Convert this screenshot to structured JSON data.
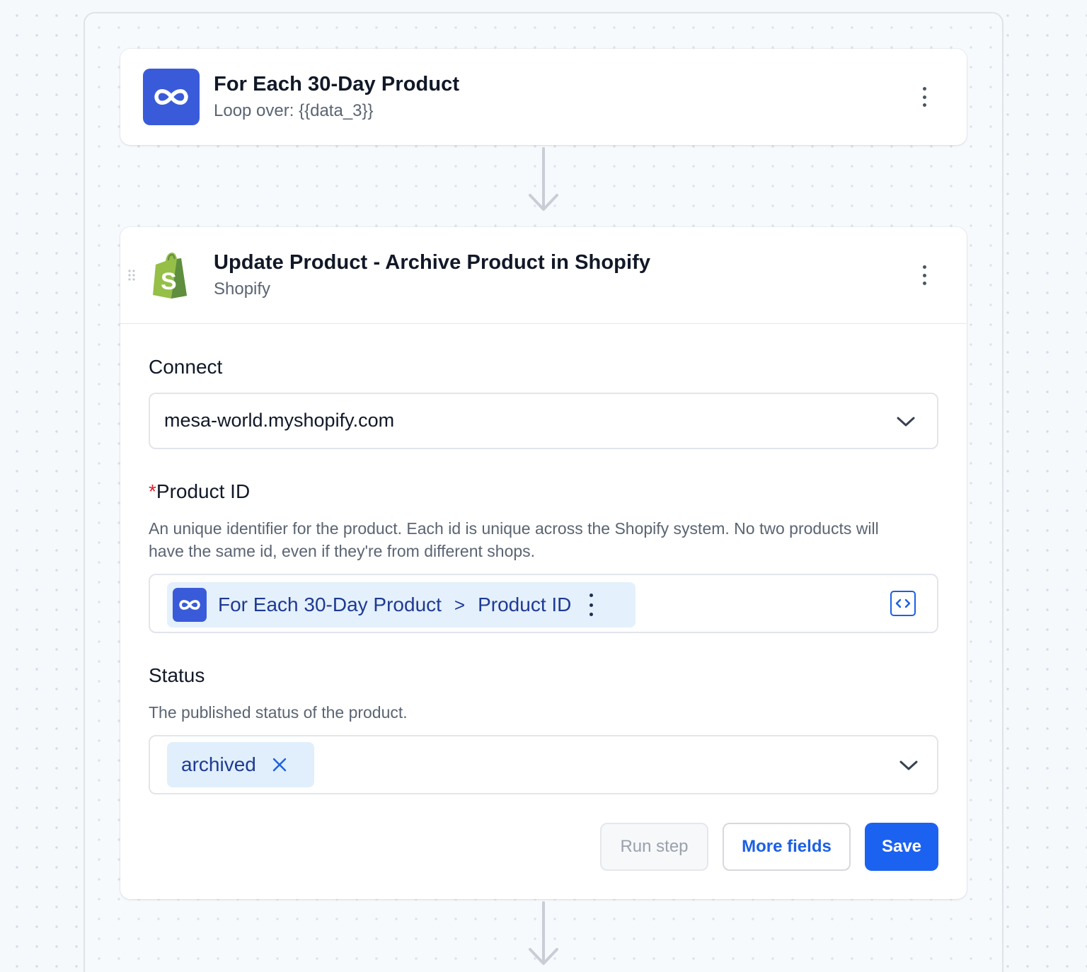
{
  "loop_step": {
    "title": "For Each 30-Day Product",
    "subtitle": "Loop over: {{data_3}}",
    "icon": "loop-infinity-icon",
    "icon_color": "#3a5bd9"
  },
  "shopify_step": {
    "title": "Update Product - Archive Product in Shopify",
    "subtitle": "Shopify",
    "icon": "shopify-bag-icon",
    "icon_color": "#95bf47"
  },
  "connect": {
    "label": "Connect",
    "value": "mesa-world.myshopify.com"
  },
  "product_id": {
    "required_mark": "*",
    "label": "Product ID",
    "help": "An unique identifier for the product. Each id is unique across the Shopify system. No two products will have the same id, even if they're from different shops.",
    "token_source": "For Each 30-Day Product",
    "token_separator": ">",
    "token_field": "Product ID"
  },
  "status": {
    "label": "Status",
    "help": "The published status of the product.",
    "selected": "archived"
  },
  "actions": {
    "run_step": "Run step",
    "more_fields": "More fields",
    "save": "Save"
  },
  "colors": {
    "accent": "#1c62f0",
    "token_bg": "#e4f0fb",
    "required": "#e11d2e"
  }
}
